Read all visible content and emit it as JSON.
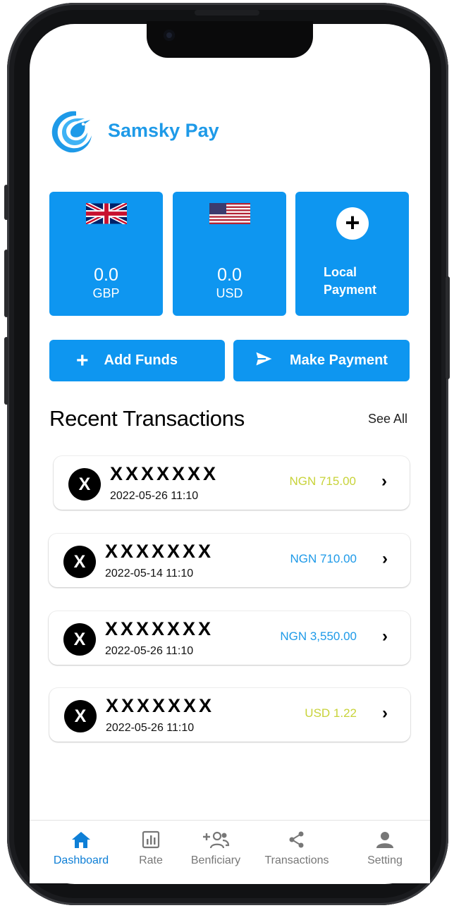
{
  "app": {
    "name": "Samsky Pay"
  },
  "colors": {
    "primary": "#0e96f0",
    "brand_text": "#1e9ae8",
    "amount_yellow": "#c8d33a",
    "amount_blue": "#1e9ae8",
    "nav_active": "#0e7fd6"
  },
  "balances": [
    {
      "icon": "uk-flag-icon",
      "amount": "0.0",
      "currency": "GBP"
    },
    {
      "icon": "us-flag-icon",
      "amount": "0.0",
      "currency": "USD"
    }
  ],
  "local_payment": {
    "icon": "plus-icon",
    "line1": "Local",
    "line2": "Payment"
  },
  "actions": {
    "add_funds": "Add Funds",
    "make_payment": "Make Payment"
  },
  "recent": {
    "title": "Recent Transactions",
    "see_all": "See All",
    "items": [
      {
        "initial": "X",
        "name": "XXXXXXX",
        "date": "2022-05-26 11:10",
        "amount": "NGN 715.00",
        "amount_color": "#c8d33a"
      },
      {
        "initial": "X",
        "name": "XXXXXXX",
        "date": "2022-05-14 11:10",
        "amount": "NGN 710.00",
        "amount_color": "#1e9ae8"
      },
      {
        "initial": "X",
        "name": "XXXXXXX",
        "date": "2022-05-26 11:10",
        "amount": "NGN 3,550.00",
        "amount_color": "#1e9ae8"
      },
      {
        "initial": "X",
        "name": "XXXXXXX",
        "date": "2022-05-26 11:10",
        "amount": "USD 1.22",
        "amount_color": "#c8d33a"
      }
    ]
  },
  "nav": {
    "items": [
      {
        "label": "Dashboard",
        "icon": "home-icon",
        "active": true
      },
      {
        "label": "Rate",
        "icon": "bar-chart-icon",
        "active": false
      },
      {
        "label": "Benficiary",
        "icon": "add-user-icon",
        "active": false
      },
      {
        "label": "Transactions",
        "icon": "share-icon",
        "active": false
      },
      {
        "label": "Setting",
        "icon": "person-icon",
        "active": false
      }
    ]
  }
}
